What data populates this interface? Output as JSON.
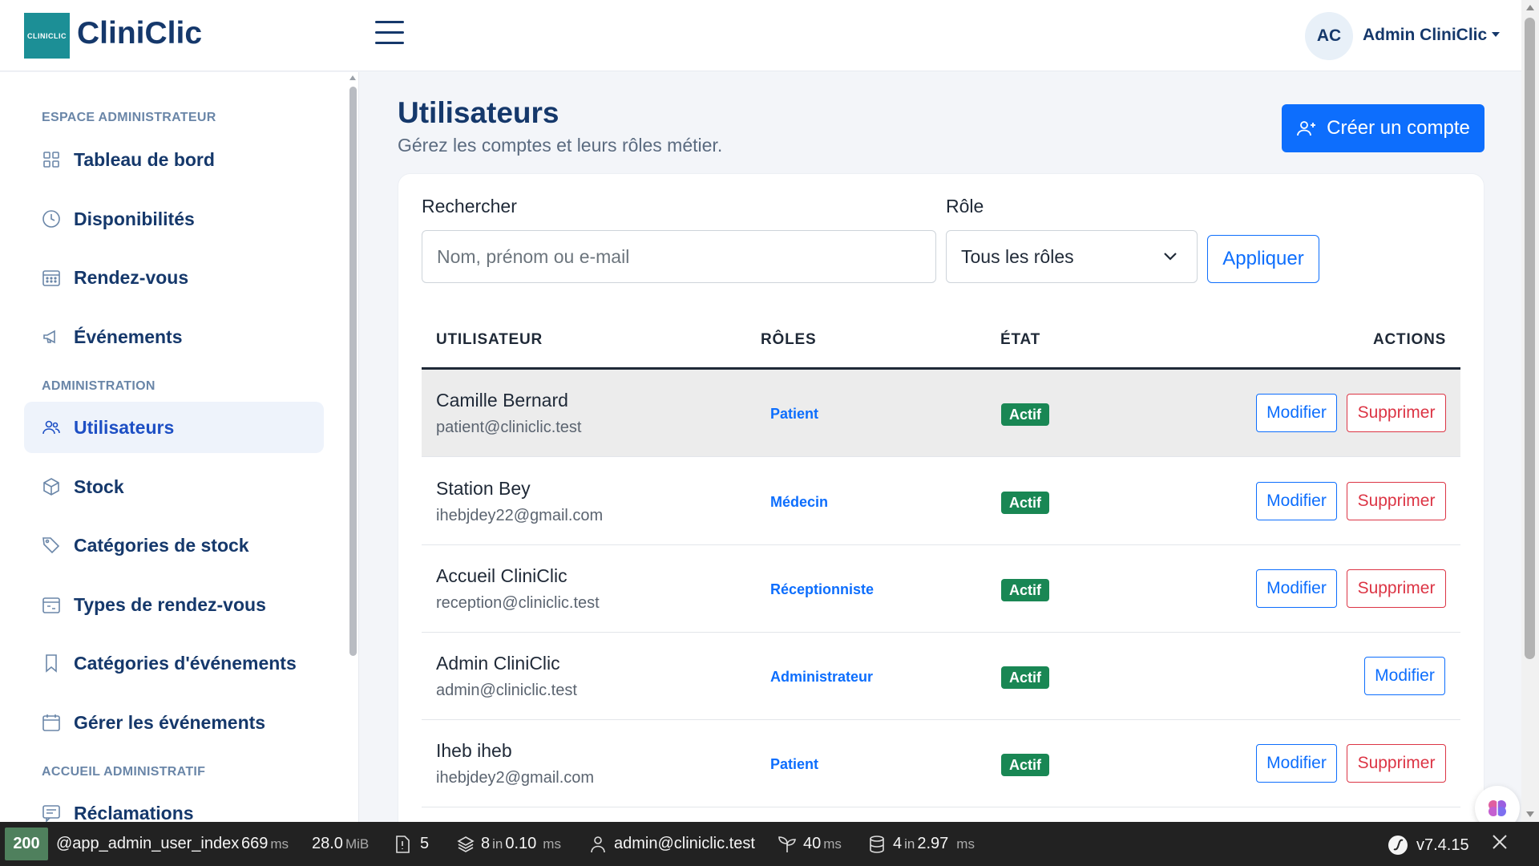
{
  "header": {
    "logo_text": "CLINICLIC",
    "brand": "CliniClic",
    "avatar_initials": "AC",
    "user_name": "Admin CliniClic"
  },
  "sidebar": {
    "sections": [
      {
        "label": "ESPACE ADMINISTRATEUR"
      },
      {
        "label": "ADMINISTRATION"
      },
      {
        "label": "ACCUEIL ADMINISTRATIF"
      }
    ],
    "items": [
      {
        "label": "Tableau de bord",
        "icon": "grid-icon"
      },
      {
        "label": "Disponibilités",
        "icon": "clock-icon"
      },
      {
        "label": "Rendez-vous",
        "icon": "calendar-icon"
      },
      {
        "label": "Événements",
        "icon": "megaphone-icon"
      },
      {
        "label": "Utilisateurs",
        "icon": "users-icon",
        "active": true
      },
      {
        "label": "Stock",
        "icon": "box-icon"
      },
      {
        "label": "Catégories de stock",
        "icon": "tags-icon"
      },
      {
        "label": "Types de rendez-vous",
        "icon": "calendar-range-icon"
      },
      {
        "label": "Catégories d'événements",
        "icon": "bookmark-icon"
      },
      {
        "label": "Gérer les événements",
        "icon": "calendar-blank-icon"
      },
      {
        "label": "Réclamations",
        "icon": "chat-icon"
      }
    ]
  },
  "main": {
    "title": "Utilisateurs",
    "subtitle": "Gérez les comptes et leurs rôles métier.",
    "create_button": "Créer un compte",
    "filters": {
      "search_label": "Rechercher",
      "search_placeholder": "Nom, prénom ou e-mail",
      "search_value": "",
      "role_label": "Rôle",
      "role_selected": "Tous les rôles",
      "apply_button": "Appliquer"
    },
    "table": {
      "columns": [
        "UTILISATEUR",
        "RÔLES",
        "ÉTAT",
        "ACTIONS"
      ],
      "rows": [
        {
          "name": "Camille Bernard",
          "email": "patient@cliniclic.test",
          "role": "Patient",
          "status": "Actif",
          "edit": "Modifier",
          "delete": "Supprimer"
        },
        {
          "name": "Station Bey",
          "email": "ihebjdey22@gmail.com",
          "role": "Médecin",
          "status": "Actif",
          "edit": "Modifier",
          "delete": "Supprimer"
        },
        {
          "name": "Accueil CliniClic",
          "email": "reception@cliniclic.test",
          "role": "Réceptionniste",
          "status": "Actif",
          "edit": "Modifier",
          "delete": "Supprimer"
        },
        {
          "name": "Admin CliniClic",
          "email": "admin@cliniclic.test",
          "role": "Administrateur",
          "status": "Actif",
          "edit": "Modifier",
          "delete": null
        },
        {
          "name": "Iheb iheb",
          "email": "ihebjdey2@gmail.com",
          "role": "Patient",
          "status": "Actif",
          "edit": "Modifier",
          "delete": "Supprimer"
        }
      ]
    }
  },
  "debug_toolbar": {
    "status_code": "200",
    "route": "@app_admin_user_index",
    "time": "669",
    "time_unit": "ms",
    "memory": "28.0",
    "memory_unit": "MiB",
    "logs": "5",
    "templates_count": "8",
    "templates_in": "in",
    "templates_time": "0.10",
    "templates_unit": "ms",
    "user": "admin@cliniclic.test",
    "init_time": "40",
    "init_unit": "ms",
    "queries_count": "4",
    "queries_in": "in",
    "queries_time": "2.97",
    "queries_unit": "ms",
    "symfony_version": "v7.4.15"
  },
  "colors": {
    "primary": "#0d6efd",
    "navy": "#15386b",
    "success": "#198754",
    "danger": "#dc3545",
    "debug_ok": "#4f805d"
  }
}
